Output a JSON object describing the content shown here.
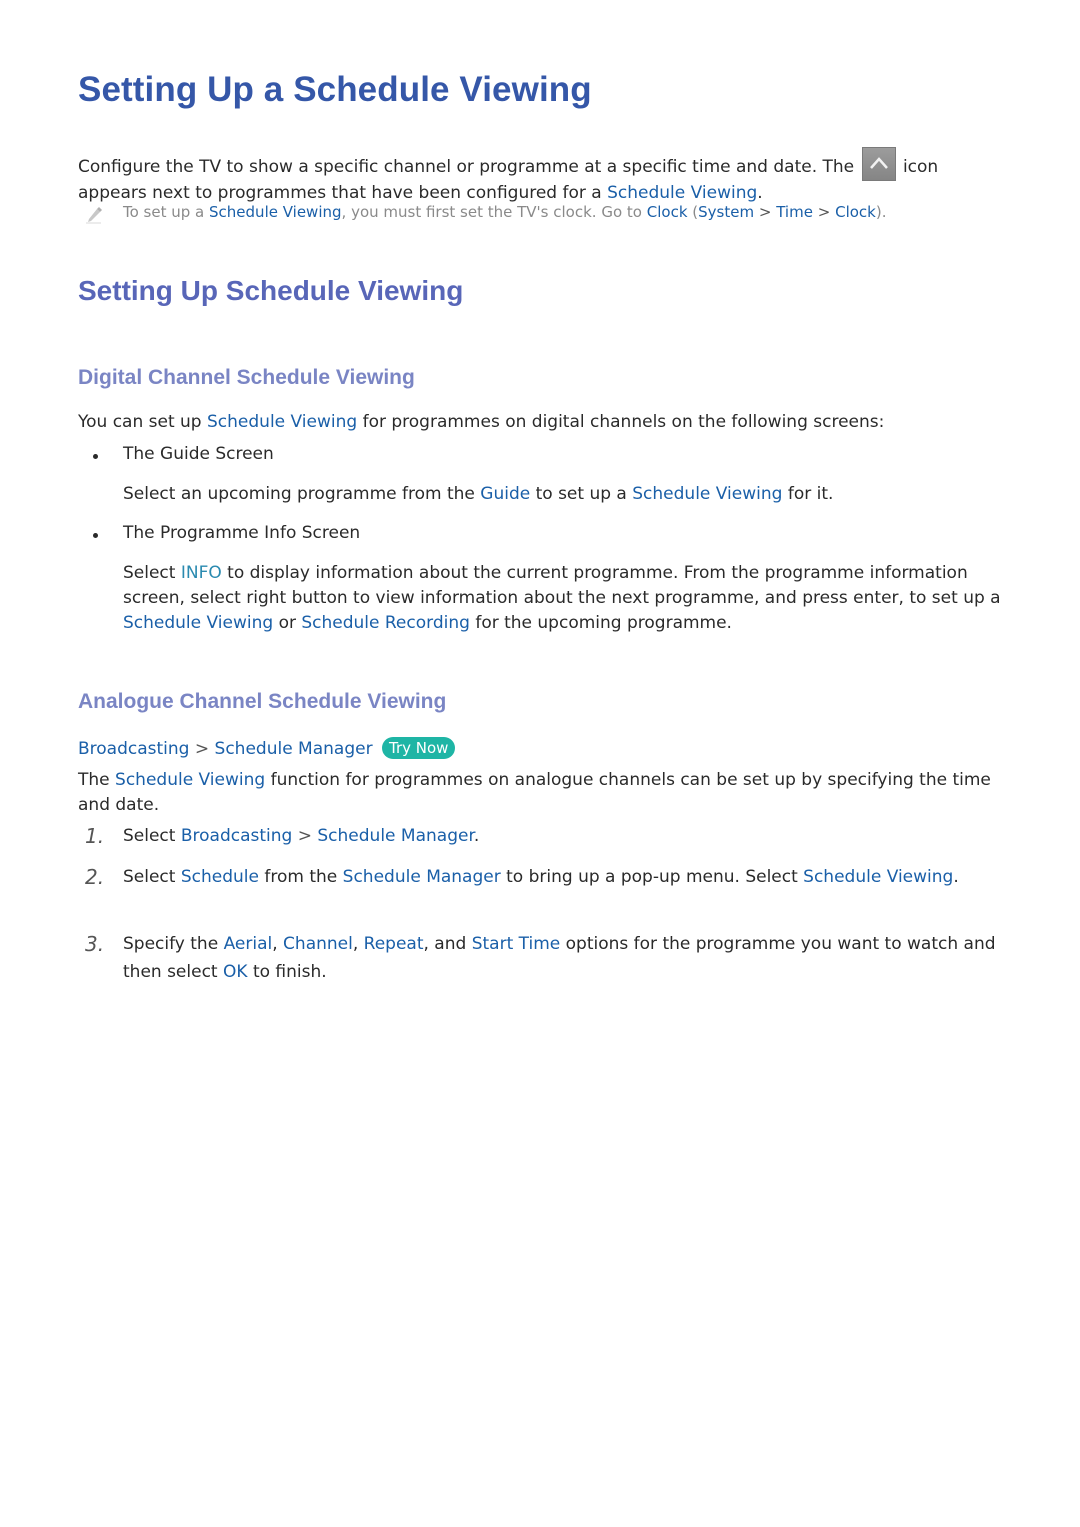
{
  "title": "Setting Up a Schedule Viewing",
  "intro": {
    "part1": "Configure the TV to show a specific channel or programme at a specific time and date. The",
    "icon": "schedule-up-arrow-icon",
    "part2": "icon appears next to programmes that have been configured for a",
    "link": "Schedule Viewing",
    "end": "."
  },
  "note": {
    "icon": "pencil-icon",
    "t1": "To set up a",
    "l1": "Schedule Viewing",
    "t2": ", you must first set the TV's clock. Go to",
    "l2": "Clock",
    "t3": "(",
    "l3": "System",
    "sep": ">",
    "l4": "Time",
    "l5": "Clock",
    "t4": ")."
  },
  "section_title": "Setting Up Schedule Viewing",
  "digital": {
    "heading": "Digital Channel Schedule Viewing",
    "intro_t1": "You can set up",
    "intro_l1": "Schedule Viewing",
    "intro_t2": "for programmes on digital channels on the following screens:",
    "items": [
      {
        "label": "The Guide Screen",
        "t1": "Select an upcoming programme from the",
        "l1": "Guide",
        "t2": "to set up a",
        "l2": "Schedule Viewing",
        "t3": "for it."
      },
      {
        "label": "The Programme Info Screen",
        "t1": "Select",
        "l1": "INFO",
        "t2": "to display information about the current programme. From the programme information screen, select right button to view information about the next programme, and press enter, to set up a",
        "l2": "Schedule Viewing",
        "t3": "or",
        "l3": "Schedule Recording",
        "t4": "for the upcoming programme."
      }
    ]
  },
  "analogue": {
    "heading": "Analogue Channel Schedule Viewing",
    "breadcrumb": [
      "Broadcasting",
      "Schedule Manager"
    ],
    "breadcrumb_sep": ">",
    "try_now": "Try Now",
    "intro_t1": "The",
    "intro_l1": "Schedule Viewing",
    "intro_t2": "function for programmes on analogue channels can be set up by specifying the time and date.",
    "steps": [
      {
        "num": "1.",
        "t1": "Select",
        "l1": "Broadcasting",
        "sep": ">",
        "l2": "Schedule Manager",
        "t2": "."
      },
      {
        "num": "2.",
        "t1": "Select",
        "l1": "Schedule",
        "t2": "from the",
        "l2": "Schedule Manager",
        "t3": "to bring up a pop-up menu. Select",
        "l3": "Schedule Viewing",
        "t4": "."
      },
      {
        "num": "3.",
        "t1": "Specify the",
        "l1": "Aerial",
        "c1": ",",
        "l2": "Channel",
        "c2": ",",
        "l3": "Repeat",
        "t2": ", and",
        "l4": "Start Time",
        "t3": "options for the programme you want to watch and then select",
        "l5": "OK",
        "t4": "to finish."
      }
    ]
  }
}
